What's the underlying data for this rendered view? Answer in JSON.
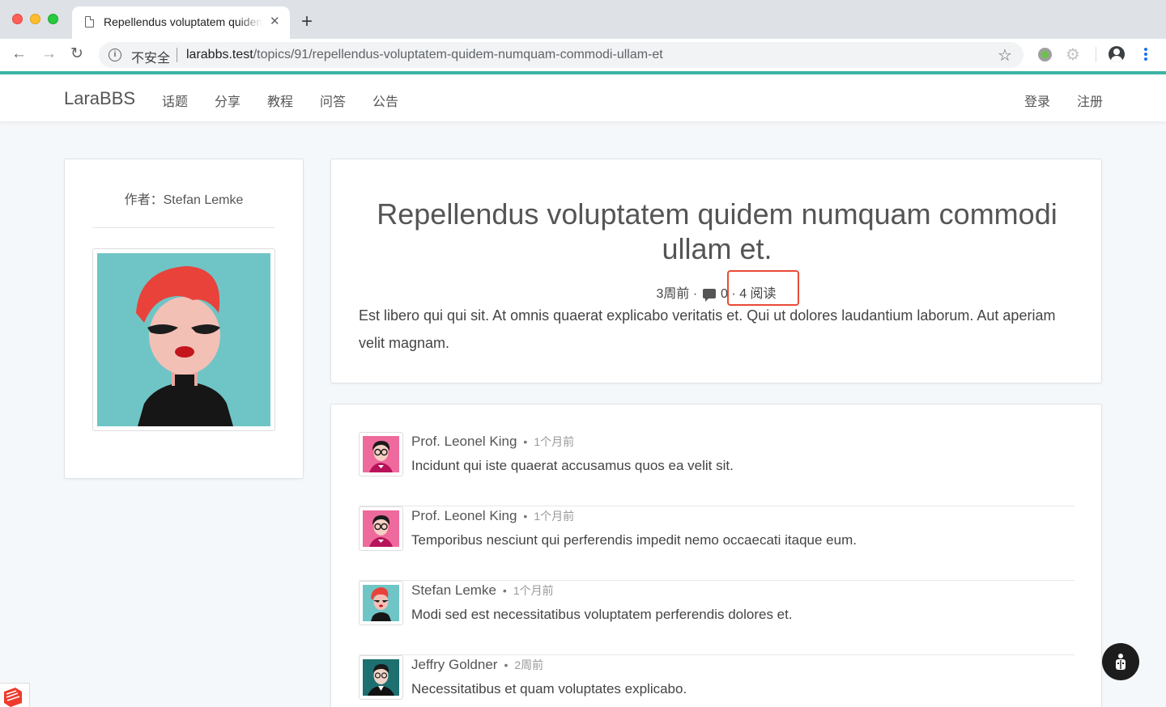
{
  "browser": {
    "tab_title": "Repellendus voluptatem quidem numquam commodi ullam et",
    "security_label": "不安全",
    "url_host": "larabbs.test",
    "url_path": "/topics/91/repellendus-voluptatem-quidem-numquam-commodi-ullam-et",
    "icons": [
      "back-icon",
      "forward-icon",
      "reload-icon",
      "info-icon",
      "star-icon",
      "account-icon",
      "menu-icon"
    ]
  },
  "navbar": {
    "brand": "LaraBBS",
    "links": [
      "话题",
      "分享",
      "教程",
      "问答",
      "公告"
    ],
    "auth": {
      "login": "登录",
      "register": "注册"
    },
    "accent_color": "#3bb4a4"
  },
  "author": {
    "label": "作者：Stefan Lemke"
  },
  "topic": {
    "title": "Repellendus voluptatem quidem numquam commodi ullam et.",
    "created": "3周前",
    "reply_count": "0",
    "views": "4 阅读",
    "body": "Est libero qui qui sit. At omnis quaerat explicabo veritatis et. Qui ut dolores laudantium laborum. Aut aperiam velit magnam."
  },
  "replies": [
    {
      "author": "Prof. Leonel King",
      "time": "1个月前",
      "text": "Incidunt qui iste quaerat accusamus quos ea velit sit."
    },
    {
      "author": "Prof. Leonel King",
      "time": "1个月前",
      "text": "Temporibus nesciunt qui perferendis impedit nemo occaecati itaque eum."
    },
    {
      "author": "Stefan Lemke",
      "time": "1个月前",
      "text": "Modi sed est necessitatibus voluptatem perferendis dolores et."
    },
    {
      "author": "Jeffry Goldner",
      "time": "2周前",
      "text": "Necessitatibus et quam voluptates explicabo."
    }
  ],
  "highlight_color": "#e94b35"
}
